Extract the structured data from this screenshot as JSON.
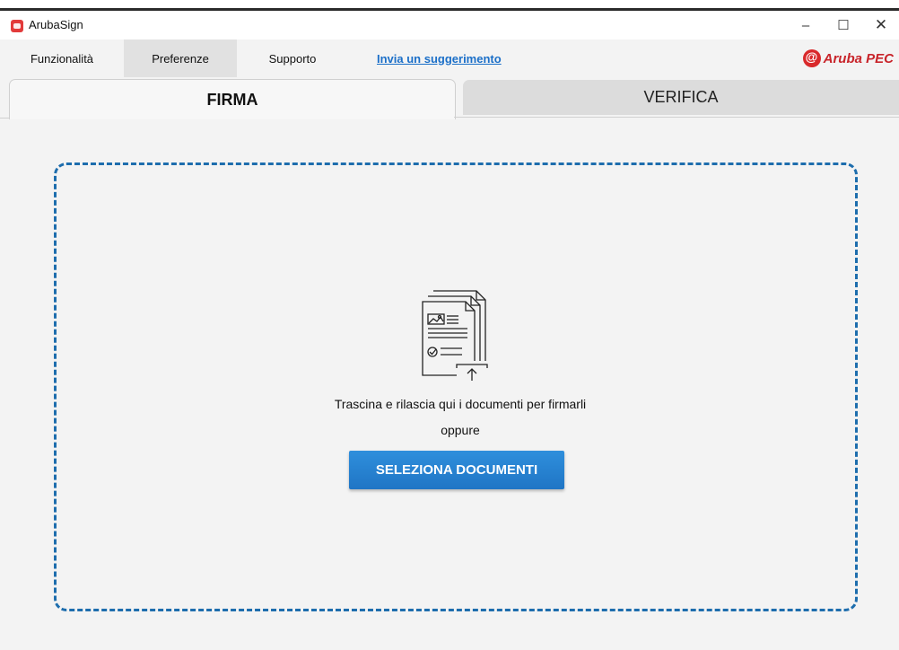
{
  "window": {
    "title": "ArubaSign",
    "minimize": "–",
    "maximize": "☐",
    "close": "✕"
  },
  "menu": {
    "items": [
      "Funzionalità",
      "Preferenze",
      "Supporto"
    ],
    "link": "Invia un suggerimento"
  },
  "brand": {
    "text": "Aruba PEC",
    "icon": "aruba-at-logo-icon",
    "color": "#d9292b"
  },
  "tabs": [
    {
      "label": "FIRMA",
      "active": true
    },
    {
      "label": "VERIFICA",
      "active": false
    }
  ],
  "dropzone": {
    "icon": "document-upload-icon",
    "instruction": "Trascina e rilascia qui i documenti per firmarli",
    "or": "oppure",
    "button": "SELEZIONA DOCUMENTI",
    "border_color": "#1d6dad",
    "button_color": "#2a86d6"
  }
}
